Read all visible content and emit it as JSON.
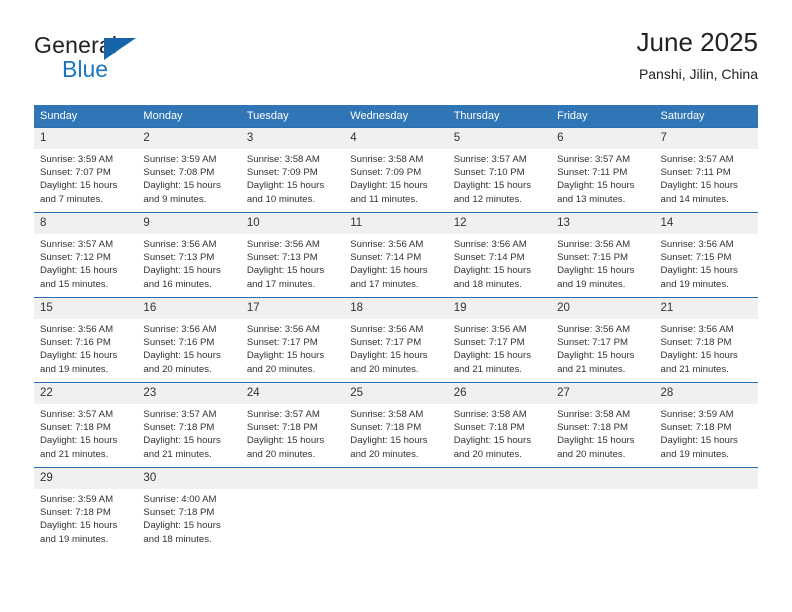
{
  "brand": {
    "name_top": "General",
    "name_bottom": "Blue",
    "triangle_color": "#1565a8",
    "blue_text_color": "#1b77bd"
  },
  "header": {
    "title": "June 2025",
    "subtitle": "Panshi, Jilin, China"
  },
  "theme": {
    "header_band": "#3075b5",
    "row_divider": "#2a6fb0",
    "daynum_band": "#f0f0f0",
    "text": "#333333"
  },
  "weekdays": [
    "Sunday",
    "Monday",
    "Tuesday",
    "Wednesday",
    "Thursday",
    "Friday",
    "Saturday"
  ],
  "weeks": [
    [
      {
        "day": "1",
        "sunrise": "Sunrise: 3:59 AM",
        "sunset": "Sunset: 7:07 PM",
        "daylight1": "Daylight: 15 hours",
        "daylight2": "and 7 minutes."
      },
      {
        "day": "2",
        "sunrise": "Sunrise: 3:59 AM",
        "sunset": "Sunset: 7:08 PM",
        "daylight1": "Daylight: 15 hours",
        "daylight2": "and 9 minutes."
      },
      {
        "day": "3",
        "sunrise": "Sunrise: 3:58 AM",
        "sunset": "Sunset: 7:09 PM",
        "daylight1": "Daylight: 15 hours",
        "daylight2": "and 10 minutes."
      },
      {
        "day": "4",
        "sunrise": "Sunrise: 3:58 AM",
        "sunset": "Sunset: 7:09 PM",
        "daylight1": "Daylight: 15 hours",
        "daylight2": "and 11 minutes."
      },
      {
        "day": "5",
        "sunrise": "Sunrise: 3:57 AM",
        "sunset": "Sunset: 7:10 PM",
        "daylight1": "Daylight: 15 hours",
        "daylight2": "and 12 minutes."
      },
      {
        "day": "6",
        "sunrise": "Sunrise: 3:57 AM",
        "sunset": "Sunset: 7:11 PM",
        "daylight1": "Daylight: 15 hours",
        "daylight2": "and 13 minutes."
      },
      {
        "day": "7",
        "sunrise": "Sunrise: 3:57 AM",
        "sunset": "Sunset: 7:11 PM",
        "daylight1": "Daylight: 15 hours",
        "daylight2": "and 14 minutes."
      }
    ],
    [
      {
        "day": "8",
        "sunrise": "Sunrise: 3:57 AM",
        "sunset": "Sunset: 7:12 PM",
        "daylight1": "Daylight: 15 hours",
        "daylight2": "and 15 minutes."
      },
      {
        "day": "9",
        "sunrise": "Sunrise: 3:56 AM",
        "sunset": "Sunset: 7:13 PM",
        "daylight1": "Daylight: 15 hours",
        "daylight2": "and 16 minutes."
      },
      {
        "day": "10",
        "sunrise": "Sunrise: 3:56 AM",
        "sunset": "Sunset: 7:13 PM",
        "daylight1": "Daylight: 15 hours",
        "daylight2": "and 17 minutes."
      },
      {
        "day": "11",
        "sunrise": "Sunrise: 3:56 AM",
        "sunset": "Sunset: 7:14 PM",
        "daylight1": "Daylight: 15 hours",
        "daylight2": "and 17 minutes."
      },
      {
        "day": "12",
        "sunrise": "Sunrise: 3:56 AM",
        "sunset": "Sunset: 7:14 PM",
        "daylight1": "Daylight: 15 hours",
        "daylight2": "and 18 minutes."
      },
      {
        "day": "13",
        "sunrise": "Sunrise: 3:56 AM",
        "sunset": "Sunset: 7:15 PM",
        "daylight1": "Daylight: 15 hours",
        "daylight2": "and 19 minutes."
      },
      {
        "day": "14",
        "sunrise": "Sunrise: 3:56 AM",
        "sunset": "Sunset: 7:15 PM",
        "daylight1": "Daylight: 15 hours",
        "daylight2": "and 19 minutes."
      }
    ],
    [
      {
        "day": "15",
        "sunrise": "Sunrise: 3:56 AM",
        "sunset": "Sunset: 7:16 PM",
        "daylight1": "Daylight: 15 hours",
        "daylight2": "and 19 minutes."
      },
      {
        "day": "16",
        "sunrise": "Sunrise: 3:56 AM",
        "sunset": "Sunset: 7:16 PM",
        "daylight1": "Daylight: 15 hours",
        "daylight2": "and 20 minutes."
      },
      {
        "day": "17",
        "sunrise": "Sunrise: 3:56 AM",
        "sunset": "Sunset: 7:17 PM",
        "daylight1": "Daylight: 15 hours",
        "daylight2": "and 20 minutes."
      },
      {
        "day": "18",
        "sunrise": "Sunrise: 3:56 AM",
        "sunset": "Sunset: 7:17 PM",
        "daylight1": "Daylight: 15 hours",
        "daylight2": "and 20 minutes."
      },
      {
        "day": "19",
        "sunrise": "Sunrise: 3:56 AM",
        "sunset": "Sunset: 7:17 PM",
        "daylight1": "Daylight: 15 hours",
        "daylight2": "and 21 minutes."
      },
      {
        "day": "20",
        "sunrise": "Sunrise: 3:56 AM",
        "sunset": "Sunset: 7:17 PM",
        "daylight1": "Daylight: 15 hours",
        "daylight2": "and 21 minutes."
      },
      {
        "day": "21",
        "sunrise": "Sunrise: 3:56 AM",
        "sunset": "Sunset: 7:18 PM",
        "daylight1": "Daylight: 15 hours",
        "daylight2": "and 21 minutes."
      }
    ],
    [
      {
        "day": "22",
        "sunrise": "Sunrise: 3:57 AM",
        "sunset": "Sunset: 7:18 PM",
        "daylight1": "Daylight: 15 hours",
        "daylight2": "and 21 minutes."
      },
      {
        "day": "23",
        "sunrise": "Sunrise: 3:57 AM",
        "sunset": "Sunset: 7:18 PM",
        "daylight1": "Daylight: 15 hours",
        "daylight2": "and 21 minutes."
      },
      {
        "day": "24",
        "sunrise": "Sunrise: 3:57 AM",
        "sunset": "Sunset: 7:18 PM",
        "daylight1": "Daylight: 15 hours",
        "daylight2": "and 20 minutes."
      },
      {
        "day": "25",
        "sunrise": "Sunrise: 3:58 AM",
        "sunset": "Sunset: 7:18 PM",
        "daylight1": "Daylight: 15 hours",
        "daylight2": "and 20 minutes."
      },
      {
        "day": "26",
        "sunrise": "Sunrise: 3:58 AM",
        "sunset": "Sunset: 7:18 PM",
        "daylight1": "Daylight: 15 hours",
        "daylight2": "and 20 minutes."
      },
      {
        "day": "27",
        "sunrise": "Sunrise: 3:58 AM",
        "sunset": "Sunset: 7:18 PM",
        "daylight1": "Daylight: 15 hours",
        "daylight2": "and 20 minutes."
      },
      {
        "day": "28",
        "sunrise": "Sunrise: 3:59 AM",
        "sunset": "Sunset: 7:18 PM",
        "daylight1": "Daylight: 15 hours",
        "daylight2": "and 19 minutes."
      }
    ],
    [
      {
        "day": "29",
        "sunrise": "Sunrise: 3:59 AM",
        "sunset": "Sunset: 7:18 PM",
        "daylight1": "Daylight: 15 hours",
        "daylight2": "and 19 minutes."
      },
      {
        "day": "30",
        "sunrise": "Sunrise: 4:00 AM",
        "sunset": "Sunset: 7:18 PM",
        "daylight1": "Daylight: 15 hours",
        "daylight2": "and 18 minutes."
      },
      {
        "day": "",
        "sunrise": "",
        "sunset": "",
        "daylight1": "",
        "daylight2": ""
      },
      {
        "day": "",
        "sunrise": "",
        "sunset": "",
        "daylight1": "",
        "daylight2": ""
      },
      {
        "day": "",
        "sunrise": "",
        "sunset": "",
        "daylight1": "",
        "daylight2": ""
      },
      {
        "day": "",
        "sunrise": "",
        "sunset": "",
        "daylight1": "",
        "daylight2": ""
      },
      {
        "day": "",
        "sunrise": "",
        "sunset": "",
        "daylight1": "",
        "daylight2": ""
      }
    ]
  ]
}
